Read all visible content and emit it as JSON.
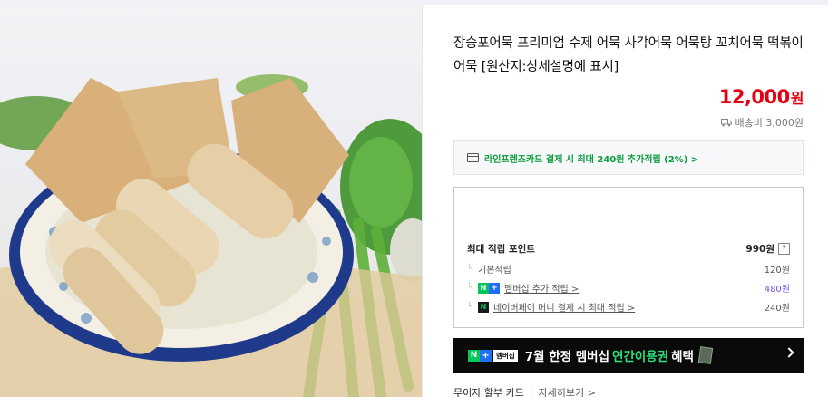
{
  "product": {
    "title": "장승포어묵 프리미엄 수제 어묵 사각어묵 어묵탕 꼬치어묵 떡볶이어묵 [원산지:상세설명에 표시]",
    "price": "12,000",
    "price_unit": "원",
    "shipping": "배송비 3,000원"
  },
  "card_benefit": {
    "text": "라인프렌즈카드 결제 시 최대 240원 추가적립 (2%) >"
  },
  "points": {
    "max_label": "최대 적립 포인트",
    "max_value": "990원",
    "help": "?",
    "rows": [
      {
        "label": "기본적립",
        "value": "120원"
      },
      {
        "label": "멤버십 추가 적립 >",
        "value": "480원"
      },
      {
        "label": "네이버페이 머니 결제 시 최대 적립 >",
        "value": "240원"
      }
    ]
  },
  "membership_banner": {
    "badge_n": "N",
    "badge_plus": "+",
    "badge_tag": "멤버십",
    "text_before": "7월 한정 멤버십",
    "text_highlight": "연간이용권",
    "text_after": "혜택"
  },
  "installment": {
    "label": "무이자 할부 카드",
    "more": "자세히보기 >"
  },
  "colors": {
    "price": "#e60012",
    "benefit_green": "#0b9b3d",
    "member_purple": "#6e4fe0",
    "banner_bg": "#0a0a0a"
  }
}
